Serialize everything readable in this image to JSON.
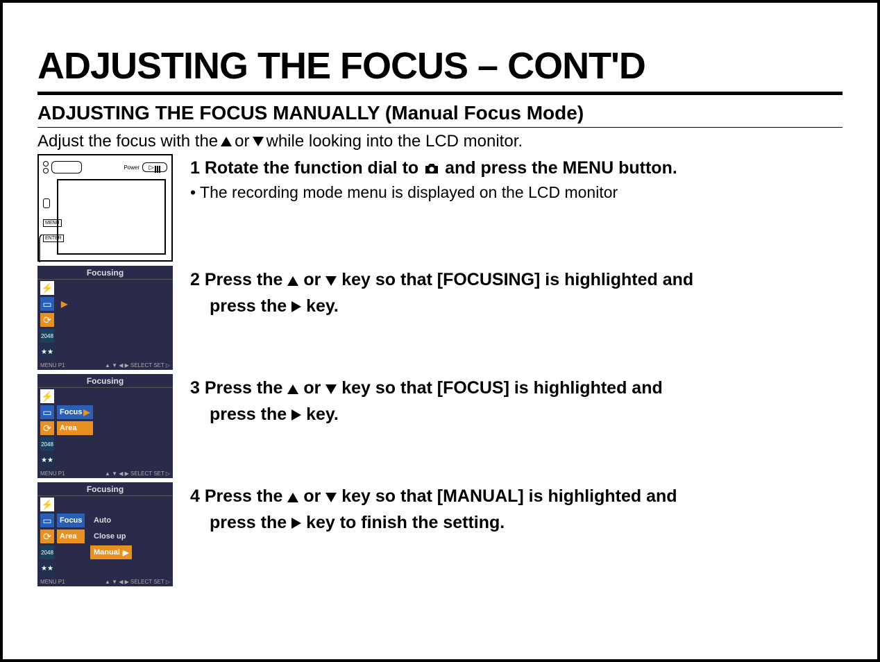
{
  "title": "ADJUSTING THE FOCUS – CONT'D",
  "subtitle": "ADJUSTING THE FOCUS MANUALLY (Manual Focus Mode)",
  "intro_pre": "Adjust the focus with the ",
  "intro_mid": " or ",
  "intro_post": " while looking into the LCD monitor.",
  "step1": {
    "bold_pre": "1 Rotate the function dial to ",
    "bold_post": " and press the MENU button.",
    "note": "• The recording mode menu is displayed on the LCD monitor"
  },
  "step2": {
    "l1_pre": "2 Press the ",
    "l1_mid": " or ",
    "l1_post": " key so that [FOCUSING] is highlighted and",
    "l2_pre": "press the ",
    "l2_post": " key."
  },
  "step3": {
    "l1_pre": "3 Press the ",
    "l1_mid": " or ",
    "l1_post": " key so that [FOCUS] is highlighted and",
    "l2_pre": "press the ",
    "l2_post": " key."
  },
  "step4": {
    "l1_pre": "4 Press the ",
    "l1_mid": " or ",
    "l1_post": " key so that [MANUAL] is highlighted and",
    "l2_pre": "press the ",
    "l2_post": " key to finish the setting."
  },
  "lcd": {
    "title": "Focusing",
    "footer_left": "MENU P1",
    "footer_right": "▲ ▼ ◀ ▶ SELECT   SET ▷",
    "screen2": {
      "item1": "Focus",
      "item2": "Area"
    },
    "screen3": {
      "item1": "Focus",
      "item2": "Area",
      "opt1": "Auto",
      "opt2": "Close up",
      "opt3": "Manual"
    }
  },
  "cam": {
    "power_label": "Power",
    "menu_label": "MENU",
    "enter_label": "ENTER"
  }
}
